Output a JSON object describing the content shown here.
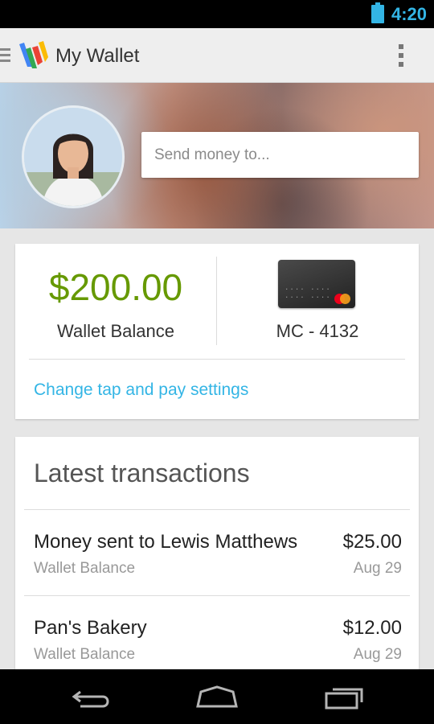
{
  "status_bar": {
    "time": "4:20"
  },
  "action_bar": {
    "title": "My Wallet"
  },
  "send": {
    "placeholder": "Send money to..."
  },
  "balance": {
    "amount": "$200.00",
    "label": "Wallet Balance",
    "amount_color": "#669900"
  },
  "card": {
    "label": "MC - 4132",
    "dots": ".... .... .... ...."
  },
  "tap_pay_link": "Change tap and pay settings",
  "transactions": {
    "title": "Latest transactions",
    "items": [
      {
        "name": "Money sent to Lewis Matthews",
        "source": "Wallet Balance",
        "amount": "$25.00",
        "date": "Aug 29"
      },
      {
        "name": "Pan's Bakery",
        "source": "Wallet Balance",
        "amount": "$12.00",
        "date": "Aug 29"
      }
    ]
  },
  "colors": {
    "accent": "#33b5e5",
    "balance_green": "#669900"
  },
  "icons": [
    "battery-icon",
    "menu-icon",
    "wallet-logo-icon",
    "overflow-menu-icon",
    "back-icon",
    "home-icon",
    "recent-apps-icon"
  ]
}
